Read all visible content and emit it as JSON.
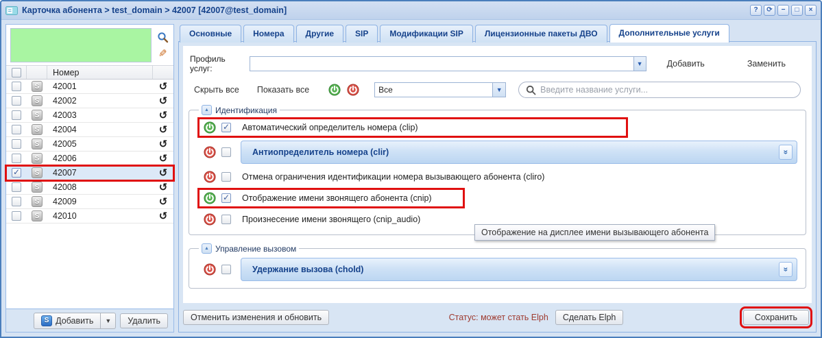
{
  "window": {
    "title": "Карточка абонента > test_domain > 42007 [42007@test_domain]",
    "controls": [
      {
        "name": "help",
        "glyph": "?"
      },
      {
        "name": "refresh",
        "glyph": "⟳"
      },
      {
        "name": "minimize",
        "glyph": "−"
      },
      {
        "name": "maximize",
        "glyph": "□"
      },
      {
        "name": "close",
        "glyph": "×"
      }
    ]
  },
  "sidebar": {
    "number_column_header": "Номер",
    "rows": [
      {
        "number": "42001",
        "checked": false,
        "selected": false
      },
      {
        "number": "42002",
        "checked": false,
        "selected": false
      },
      {
        "number": "42003",
        "checked": false,
        "selected": false
      },
      {
        "number": "42004",
        "checked": false,
        "selected": false
      },
      {
        "number": "42005",
        "checked": false,
        "selected": false
      },
      {
        "number": "42006",
        "checked": false,
        "selected": false
      },
      {
        "number": "42007",
        "checked": true,
        "selected": true,
        "annotated": true
      },
      {
        "number": "42008",
        "checked": false,
        "selected": false
      },
      {
        "number": "42009",
        "checked": false,
        "selected": false
      },
      {
        "number": "42010",
        "checked": false,
        "selected": false
      }
    ],
    "add_button": "Добавить",
    "delete_button": "Удалить"
  },
  "tabs": [
    {
      "label": "Основные",
      "active": false
    },
    {
      "label": "Номера",
      "active": false
    },
    {
      "label": "Другие",
      "active": false
    },
    {
      "label": "SIP",
      "active": false
    },
    {
      "label": "Модификации SIP",
      "active": false
    },
    {
      "label": "Лицензионные пакеты ДВО",
      "active": false
    },
    {
      "label": "Дополнительные услуги",
      "active": true
    }
  ],
  "service_toolbar": {
    "profile_label": "Профиль услуг:",
    "profile_value": "",
    "add_label": "Добавить",
    "replace_label": "Заменить",
    "hide_all_label": "Скрыть все",
    "show_all_label": "Показать все",
    "filter_value": "Все",
    "search_placeholder": "Введите название услуги..."
  },
  "sections": [
    {
      "title": "Идентификация",
      "services": [
        {
          "label": "Автоматический определитель номера (clip)",
          "enabled": true,
          "checked": true,
          "annotated": true,
          "expandable": false
        },
        {
          "label": "Антиопределитель номера (clir)",
          "enabled": false,
          "checked": false,
          "annotated": false,
          "expandable": true
        },
        {
          "label": "Отмена ограничения идентификации номера вызывающего абонента (cliro)",
          "enabled": false,
          "checked": false,
          "annotated": false,
          "expandable": false
        },
        {
          "label": "Отображение имени звонящего абонента (cnip)",
          "enabled": true,
          "checked": true,
          "annotated": true,
          "expandable": false
        },
        {
          "label": "Произнесение имени звонящего (cnip_audio)",
          "enabled": false,
          "checked": false,
          "annotated": false,
          "expandable": false
        }
      ]
    },
    {
      "title": "Управление вызовом",
      "services": [
        {
          "label": "Удержание вызова (chold)",
          "enabled": false,
          "checked": false,
          "annotated": false,
          "expandable": true
        }
      ]
    }
  ],
  "tooltip": {
    "text": "Отображение на дисплее имени вызывающего абонента"
  },
  "footer": {
    "cancel_button": "Отменить изменения и обновить",
    "status_text": "Статус: может стать Elph",
    "make_elph_button": "Сделать Elph",
    "save_button": "Сохранить"
  },
  "icons": {
    "sip_terminal_glyph": "S",
    "history_glyph": "↺",
    "pencil_glyph": "✎",
    "collapse_glyph": "▲",
    "dropdown_glyph": "▼",
    "expand_more_glyph": "»"
  },
  "colors": {
    "accent": "#15428b",
    "annotation": "#e01010",
    "power_on": "#57b252",
    "power_off": "#d9534a",
    "selection": "#dce9f8",
    "quick_search_bg": "#a9f5a2"
  }
}
